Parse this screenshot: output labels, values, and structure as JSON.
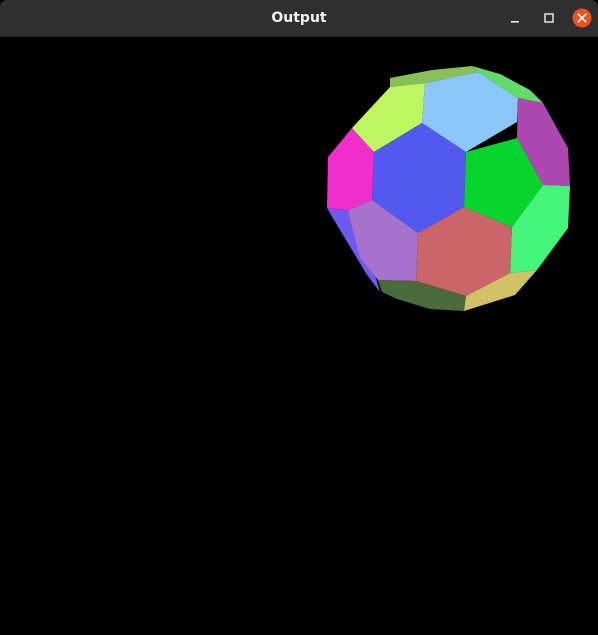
{
  "window": {
    "title": "Output",
    "controls": {
      "minimize_icon": "minimize-icon",
      "maximize_icon": "maximize-icon",
      "close_icon": "close-icon",
      "close_color": "#e95420"
    }
  },
  "scene": {
    "background": "#000000",
    "object": "truncated-icosahedron",
    "faces": [
      {
        "name": "face-blue-center",
        "color": "#5358ee"
      },
      {
        "name": "face-light-blue",
        "color": "#8bc6f9"
      },
      {
        "name": "face-lime",
        "color": "#bff560"
      },
      {
        "name": "face-magenta",
        "color": "#ef2ecb"
      },
      {
        "name": "face-green",
        "color": "#07d52e"
      },
      {
        "name": "face-purple",
        "color": "#ad48b0"
      },
      {
        "name": "face-mint",
        "color": "#45f57a"
      },
      {
        "name": "face-lavender",
        "color": "#a672cb"
      },
      {
        "name": "face-rose",
        "color": "#ca6569"
      },
      {
        "name": "face-dark-green",
        "color": "#4a6c3c"
      },
      {
        "name": "face-khaki",
        "color": "#d2c167"
      },
      {
        "name": "face-violet-edge",
        "color": "#7059ef"
      },
      {
        "name": "face-olive-top",
        "color": "#86c056"
      },
      {
        "name": "face-green-top-right",
        "color": "#5fdc6a"
      }
    ]
  }
}
